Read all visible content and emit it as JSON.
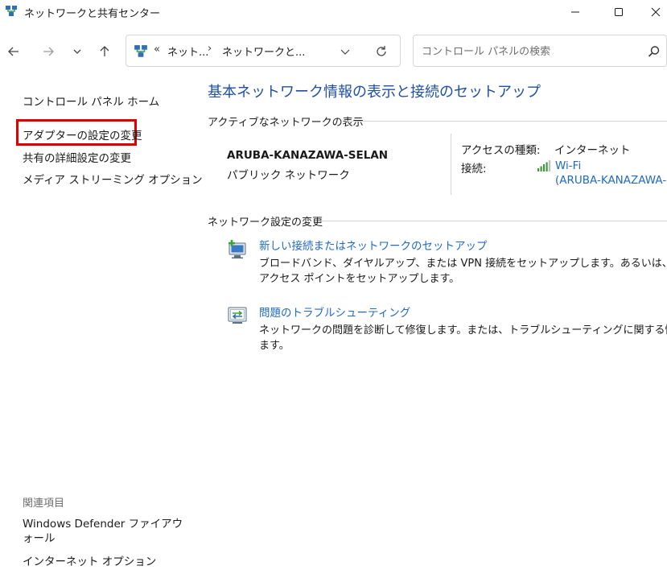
{
  "window": {
    "title": "ネットワークと共有センター"
  },
  "address_bar": {
    "overflow": "«",
    "crumb_1": "ネット...",
    "separator": "›",
    "crumb_2": "ネットワークと..."
  },
  "search": {
    "placeholder": "コントロール パネルの検索"
  },
  "sidebar": {
    "home": "コントロール パネル ホーム",
    "adapter_settings": "アダプターの設定の変更",
    "sharing_settings": "共有の詳細設定の変更",
    "media_streaming": "メディア ストリーミング オプション",
    "related_heading": "関連項目",
    "related": [
      "Windows Defender ファイアウォール",
      "インターネット オプション"
    ]
  },
  "main": {
    "title": "基本ネットワーク情報の表示と接続のセットアップ",
    "active_networks_heading": "アクティブなネットワークの表示",
    "network": {
      "name": "ARUBA-KANAZAWA-SELAN",
      "type": "パブリック ネットワーク",
      "access_type_label": "アクセスの種類:",
      "access_type_value": "インターネット",
      "connection_label": "接続:",
      "connection_value": "Wi-Fi",
      "connection_ssid": "(ARUBA-KANAZAWA-"
    },
    "change_settings_heading": "ネットワーク設定の変更",
    "tasks": [
      {
        "title": "新しい接続またはネットワークのセットアップ",
        "desc_line1": "ブロードバンド、ダイヤルアップ、または VPN 接続をセットアップします。あるいは、ルーターまたは",
        "desc_line2": "アクセス ポイントをセットアップします。"
      },
      {
        "title": "問題のトラブルシューティング",
        "desc_line1": "ネットワークの問題を診断して修復します。または、トラブルシューティングに関する情報を入手し",
        "desc_line2": "ます。"
      }
    ]
  },
  "colors": {
    "link_blue": "#1f6ac1",
    "title_blue": "#1f4fa3",
    "highlight_red": "#e00000"
  },
  "icons": {
    "title": "network-sharing-icon",
    "back": "arrow-left-icon",
    "forward": "arrow-right-icon",
    "recent": "chevron-down-icon",
    "up": "arrow-up-icon",
    "refresh": "refresh-icon",
    "search": "search-icon",
    "wifi": "wifi-signal-icon",
    "new_connection": "new-connection-icon",
    "troubleshoot": "troubleshoot-icon"
  }
}
